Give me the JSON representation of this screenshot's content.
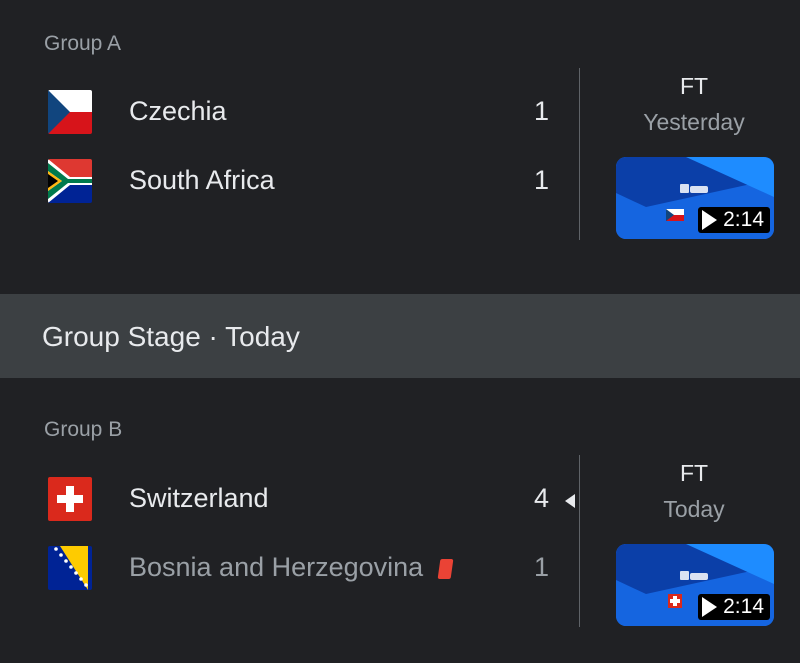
{
  "matches": [
    {
      "group": "Group A",
      "home": {
        "name": "Czechia",
        "score": "1",
        "flag": "flag-czechia"
      },
      "away": {
        "name": "South Africa",
        "score": "1",
        "flag": "flag-south-africa"
      },
      "status": "FT",
      "when": "Yesterday",
      "video_duration": "2:14"
    },
    {
      "group": "Group B",
      "home": {
        "name": "Switzerland",
        "score": "4",
        "flag": "flag-switzerland",
        "winner": true
      },
      "away": {
        "name": "Bosnia and Herzegovina",
        "score": "1",
        "flag": "flag-bosnia",
        "red_card": true
      },
      "status": "FT",
      "when": "Today",
      "video_duration": "2:14"
    }
  ],
  "stage_header": "Group Stage · Today",
  "colors": {
    "background": "#202124",
    "band": "#3c4043",
    "red_card": "#ea4335",
    "video_blue": "#1a73e8"
  }
}
